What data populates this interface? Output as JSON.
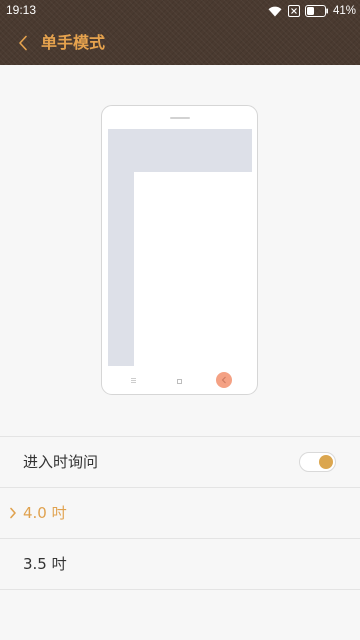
{
  "status_bar": {
    "time": "19:13",
    "battery_text": "41%",
    "battery_level": 0.41,
    "icons": [
      "wifi-icon",
      "sim-disabled-icon",
      "battery-icon"
    ]
  },
  "header": {
    "title": "单手模式",
    "back_icon": "chevron-left-icon"
  },
  "preview": {
    "icons": [
      "phone-speaker",
      "menu-icon",
      "home-icon",
      "back-icon"
    ],
    "highlight_color": "#f4a184"
  },
  "options": {
    "ask_on_enter": {
      "label": "进入时询问",
      "enabled": true
    },
    "size_4_0": {
      "label": "4.0 吋",
      "selected": true
    },
    "size_3_5": {
      "label": "3.5 吋",
      "selected": false
    }
  },
  "colors": {
    "header_bg": "#4a3a30",
    "accent": "#e6a34e",
    "toggle_knob": "#dba64f",
    "background": "#f7f7f7"
  }
}
